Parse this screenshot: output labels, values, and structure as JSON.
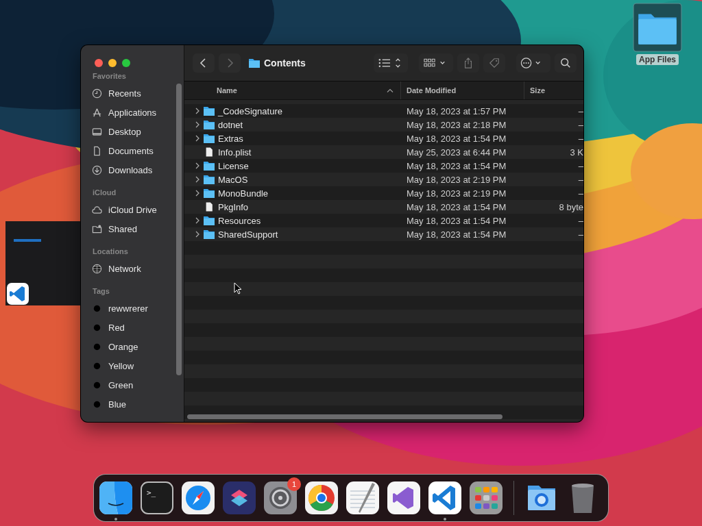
{
  "desktop_icon": {
    "label": "App Files"
  },
  "finder": {
    "title": "Contents",
    "sidebar": [
      {
        "heading": "Favorites",
        "items": [
          {
            "label": "Recents",
            "kind": "clock"
          },
          {
            "label": "Applications",
            "kind": "apps"
          },
          {
            "label": "Desktop",
            "kind": "desktop"
          },
          {
            "label": "Documents",
            "kind": "doc"
          },
          {
            "label": "Downloads",
            "kind": "download"
          }
        ]
      },
      {
        "heading": "iCloud",
        "items": [
          {
            "label": "iCloud Drive",
            "kind": "cloud"
          },
          {
            "label": "Shared",
            "kind": "shared"
          }
        ]
      },
      {
        "heading": "Locations",
        "items": [
          {
            "label": "Network",
            "kind": "globe"
          }
        ]
      },
      {
        "heading": "Tags",
        "items": [
          {
            "label": "rewwrerer",
            "kind": "tag"
          },
          {
            "label": "Red",
            "kind": "tag"
          },
          {
            "label": "Orange",
            "kind": "tag"
          },
          {
            "label": "Yellow",
            "kind": "tag"
          },
          {
            "label": "Green",
            "kind": "tag"
          },
          {
            "label": "Blue",
            "kind": "tag"
          }
        ]
      }
    ],
    "columns": [
      {
        "label": "Name",
        "sorted": true
      },
      {
        "label": "Date Modified",
        "sorted": false
      },
      {
        "label": "Size",
        "sorted": false
      }
    ],
    "rows": [
      {
        "name": "_CodeSignature",
        "kind": "folder",
        "date": "May 18, 2023 at 1:57 PM",
        "size": "–"
      },
      {
        "name": "dotnet",
        "kind": "folder",
        "date": "May 18, 2023 at 2:18 PM",
        "size": "–"
      },
      {
        "name": "Extras",
        "kind": "folder",
        "date": "May 18, 2023 at 1:54 PM",
        "size": "–"
      },
      {
        "name": "Info.plist",
        "kind": "file",
        "date": "May 25, 2023 at 6:44 PM",
        "size": "3 K"
      },
      {
        "name": "License",
        "kind": "folder",
        "date": "May 18, 2023 at 1:54 PM",
        "size": "–"
      },
      {
        "name": "MacOS",
        "kind": "folder",
        "date": "May 18, 2023 at 2:19 PM",
        "size": "–"
      },
      {
        "name": "MonoBundle",
        "kind": "folder",
        "date": "May 18, 2023 at 2:19 PM",
        "size": "–"
      },
      {
        "name": "PkgInfo",
        "kind": "file",
        "date": "May 18, 2023 at 1:54 PM",
        "size": "8 byte"
      },
      {
        "name": "Resources",
        "kind": "folder",
        "date": "May 18, 2023 at 1:54 PM",
        "size": "–"
      },
      {
        "name": "SharedSupport",
        "kind": "folder",
        "date": "May 18, 2023 at 1:54 PM",
        "size": "–"
      }
    ]
  },
  "dock": {
    "apps": [
      {
        "kind": "finder",
        "running": true
      },
      {
        "kind": "terminal",
        "running": false,
        "glyph": ">_"
      },
      {
        "kind": "safari",
        "running": false
      },
      {
        "kind": "shortcuts",
        "running": false
      },
      {
        "kind": "settings",
        "running": false,
        "badge": "1"
      },
      {
        "kind": "chrome",
        "running": false
      },
      {
        "kind": "textedit",
        "running": false
      },
      {
        "kind": "visualstudio",
        "running": false
      },
      {
        "kind": "vscode",
        "running": true
      },
      {
        "kind": "launchpad",
        "running": false
      }
    ],
    "others": [
      {
        "kind": "folder",
        "running": false
      },
      {
        "kind": "trash",
        "running": false
      }
    ]
  }
}
